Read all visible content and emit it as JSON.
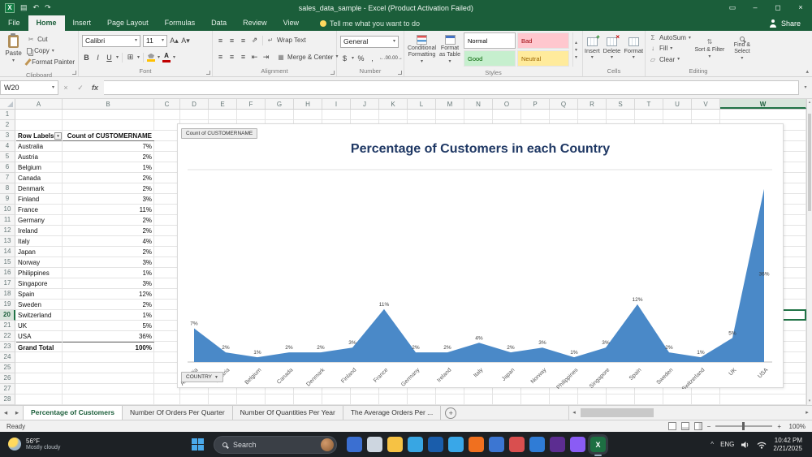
{
  "icons": {
    "dropdown": "▾",
    "save": "▤",
    "undo": "↶",
    "redo": "↷",
    "ribbon-options": "▭",
    "minimize": "–",
    "restore": "◻",
    "close": "×",
    "cancel": "×",
    "enter": "✓",
    "fx": "fx",
    "cut": "✂",
    "grow-font": "A▴",
    "shrink-font": "A▾",
    "bold": "B",
    "italic": "I",
    "underline": "U",
    "borders": "⊞",
    "align-lines": "≡",
    "orientation": "⇗",
    "wrap": "↵",
    "merge": "▦",
    "outdent": "⇤",
    "indent": "⇥",
    "dollar": "$",
    "percent": "%",
    "comma": ",",
    "inc-decimal": "←.00",
    "dec-decimal": ".00→",
    "sigma": "Σ",
    "fill-down": "↓",
    "clear": "▱",
    "sort": "⇅",
    "font-color": "A",
    "filter-caret": "▼",
    "scroll-up": "▴",
    "scroll-down": "▾",
    "scroll-left": "◂",
    "scroll-right": "▸",
    "new-sheet": "+",
    "zoom-out": "−",
    "zoom-in": "+",
    "tray-chevron": "^",
    "gallery-more": "▾"
  },
  "title_bar": {
    "title": "sales_data_sample - Excel (Product Activation Failed)"
  },
  "ribbon": {
    "tabs": [
      "File",
      "Home",
      "Insert",
      "Page Layout",
      "Formulas",
      "Data",
      "Review",
      "View"
    ],
    "active_tab": "Home",
    "tell_me": "Tell me what you want to do",
    "share": "Share",
    "clipboard": {
      "label": "Clipboard",
      "paste": "Paste",
      "cut": "Cut",
      "copy": "Copy",
      "format_painter": "Format Painter"
    },
    "font": {
      "label": "Font",
      "family": "Calibri",
      "size": "11"
    },
    "alignment": {
      "label": "Alignment",
      "wrap_text": "Wrap Text",
      "merge_center": "Merge & Center"
    },
    "number": {
      "label": "Number",
      "format": "General"
    },
    "styles": {
      "label": "Styles",
      "conditional": "Conditional Formatting",
      "format_table": "Format as Table",
      "cells": [
        {
          "label": "Normal",
          "bg": "#ffffff",
          "fg": "#000000"
        },
        {
          "label": "Bad",
          "bg": "#ffc7ce",
          "fg": "#9c0006"
        },
        {
          "label": "Good",
          "bg": "#c6efce",
          "fg": "#006100"
        },
        {
          "label": "Neutral",
          "bg": "#ffeb9c",
          "fg": "#9c6500"
        }
      ]
    },
    "cells": {
      "label": "Cells",
      "insert": "Insert",
      "delete": "Delete",
      "format": "Format"
    },
    "editing": {
      "label": "Editing",
      "autosum": "AutoSum",
      "fill": "Fill",
      "clear": "Clear",
      "sort_filter": "Sort & Filter",
      "find_select": "Find & Select"
    }
  },
  "formula_bar": {
    "name_box": "W20",
    "formula": ""
  },
  "grid": {
    "columns": [
      "A",
      "B",
      "C",
      "D",
      "E",
      "F",
      "G",
      "H",
      "I",
      "J",
      "K",
      "L",
      "M",
      "N",
      "O",
      "P",
      "Q",
      "R",
      "S",
      "T",
      "U",
      "V",
      "W"
    ],
    "selected_column": "W",
    "selected_row": 20,
    "visible_rows": 28,
    "pivot": {
      "header_row": 3,
      "headers": [
        "Row Labels",
        "Count of CUSTOMERNAME"
      ],
      "rows": [
        [
          "Australia",
          "7%"
        ],
        [
          "Austria",
          "2%"
        ],
        [
          "Belgium",
          "1%"
        ],
        [
          "Canada",
          "2%"
        ],
        [
          "Denmark",
          "2%"
        ],
        [
          "Finland",
          "3%"
        ],
        [
          "France",
          "11%"
        ],
        [
          "Germany",
          "2%"
        ],
        [
          "Ireland",
          "2%"
        ],
        [
          "Italy",
          "4%"
        ],
        [
          "Japan",
          "2%"
        ],
        [
          "Norway",
          "3%"
        ],
        [
          "Philippines",
          "1%"
        ],
        [
          "Singapore",
          "3%"
        ],
        [
          "Spain",
          "12%"
        ],
        [
          "Sweden",
          "2%"
        ],
        [
          "Switzerland",
          "1%"
        ],
        [
          "UK",
          "5%"
        ],
        [
          "USA",
          "36%"
        ]
      ],
      "total": [
        "Grand Total",
        "100%"
      ]
    }
  },
  "chart_data": {
    "type": "area",
    "title": "Percentage of Customers in each Country",
    "title_color": "#1f3864",
    "field_button": "Count of CUSTOMERNAME",
    "axis_button": "COUNTRY",
    "categories": [
      "Australia",
      "Austria",
      "Belgium",
      "Canada",
      "Denmark",
      "Finland",
      "France",
      "Germany",
      "Ireland",
      "Italy",
      "Japan",
      "Norway",
      "Philippines",
      "Singapore",
      "Spain",
      "Sweden",
      "Switzerland",
      "UK",
      "USA"
    ],
    "values": [
      7,
      2,
      1,
      2,
      2,
      3,
      11,
      2,
      2,
      4,
      2,
      3,
      1,
      3,
      12,
      2,
      1,
      5,
      36
    ],
    "labels": [
      "7%",
      "2%",
      "1%",
      "2%",
      "2%",
      "3%",
      "11%",
      "2%",
      "2%",
      "4%",
      "2%",
      "3%",
      "1%",
      "3%",
      "12%",
      "2%",
      "1%",
      "5%",
      "36%"
    ],
    "series_color": "#4a89c8",
    "ylim": [
      0,
      40
    ],
    "legend": "none",
    "grid": "minimal"
  },
  "sheet_bar": {
    "tabs": [
      "Percentage of Customers",
      "Number Of Orders Per Quarter",
      "Number Of Quantities Per Year",
      "The Average Orders Per  ..."
    ],
    "active": "Percentage of Customers"
  },
  "status_bar": {
    "ready": "Ready",
    "zoom": "100%"
  },
  "taskbar": {
    "weather_temp": "56°F",
    "weather_desc": "Mostly cloudy",
    "search": "Search",
    "apps": [
      {
        "name": "widgets",
        "color": "#3b6fd1"
      },
      {
        "name": "copilot",
        "color": "#cdd6e0"
      },
      {
        "name": "file-explorer",
        "color": "#f6c244"
      },
      {
        "name": "edge",
        "color": "#38a6e3"
      },
      {
        "name": "outlook",
        "color": "#1a5dab"
      },
      {
        "name": "store",
        "color": "#39a7e8"
      },
      {
        "name": "firefox",
        "color": "#f0701f"
      },
      {
        "name": "mail",
        "color": "#3c76d2"
      },
      {
        "name": "photos",
        "color": "#d94f4f"
      },
      {
        "name": "onedrive",
        "color": "#2f7cd6"
      },
      {
        "name": "visual-studio",
        "color": "#5c2d91"
      },
      {
        "name": "discord",
        "color": "#8a5cf5"
      },
      {
        "name": "excel",
        "color": "#1d6f42",
        "active": true,
        "glyph": "X"
      }
    ],
    "tray": {
      "lang": "ENG",
      "time": "10:42 PM",
      "date": "2/21/2025"
    }
  }
}
